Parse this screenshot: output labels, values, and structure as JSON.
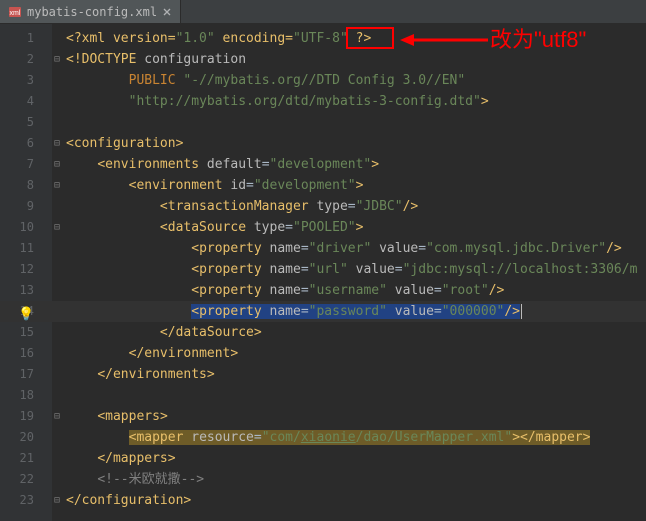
{
  "tab": {
    "filename": "mybatis-config.xml"
  },
  "annotation": {
    "label": "改为\"utf8\""
  },
  "gutter": {
    "lines": [
      "1",
      "2",
      "3",
      "4",
      "5",
      "6",
      "7",
      "8",
      "9",
      "10",
      "11",
      "12",
      "13",
      "14",
      "15",
      "16",
      "17",
      "18",
      "19",
      "20",
      "21",
      "22",
      "23"
    ],
    "highlighted_line": 14
  },
  "code": {
    "l1_a": "<?xml version=",
    "l1_b": "\"1.0\"",
    "l1_c": " encoding=",
    "l1_d": "\"UTF-8\"",
    "l1_e": " ?>",
    "l2_a": "<!DOCTYPE ",
    "l2_b": "configuration",
    "l3_a": "PUBLIC ",
    "l3_b": "\"-//mybatis.org//DTD Config 3.0//EN\"",
    "l4_a": "\"http://mybatis.org/dtd/mybatis-3-config.dtd\"",
    "l4_b": ">",
    "l6_tag": "configuration",
    "l7_tag": "environments",
    "l7_attr": "default",
    "l7_val": "\"development\"",
    "l8_tag": "environment",
    "l8_attr": "id",
    "l8_val": "\"development\"",
    "l9_tag": "transactionManager",
    "l9_attr": "type",
    "l9_val": "\"JDBC\"",
    "l10_tag": "dataSource",
    "l10_attr": "type",
    "l10_val": "\"POOLED\"",
    "prop_tag": "property",
    "name_attr": "name",
    "value_attr": "value",
    "l11_nv": "\"driver\"",
    "l11_vv": "\"com.mysql.jdbc.Driver\"",
    "l12_nv": "\"url\"",
    "l12_vv": "\"jdbc:mysql://localhost:3306/m",
    "l13_nv": "\"username\"",
    "l13_vv": "\"root\"",
    "l14_nv": "\"password\"",
    "l14_vv": "\"000000\"",
    "l19_tag": "mappers",
    "l20_tag": "mapper",
    "l20_attr": "resource",
    "l20_val": "\"com/",
    "l20_u": "xiaonie",
    "l20_val2": "/dao/UserMapper.xml\"",
    "l22_cmt": "<!--米欧就撒-->"
  }
}
